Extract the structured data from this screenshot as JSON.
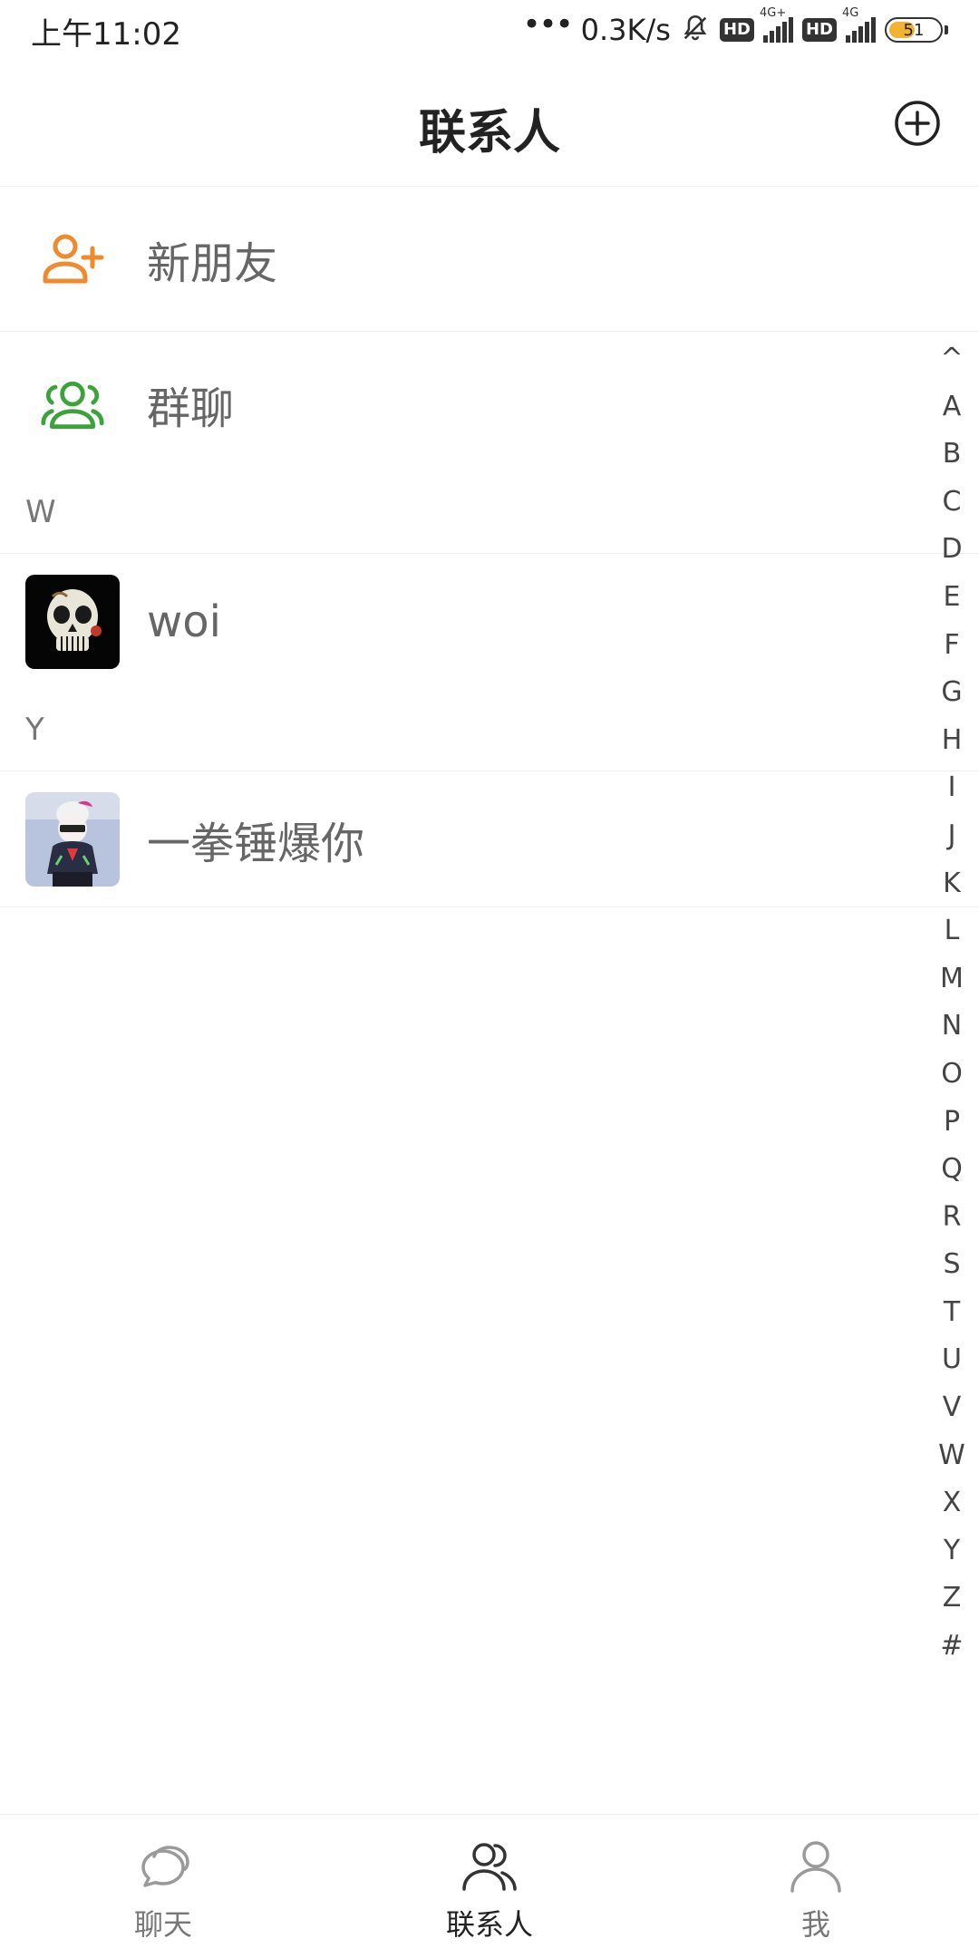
{
  "status_bar": {
    "time": "上午11:02",
    "dots": "•••",
    "speed": "0.3K/s",
    "hd1": "HD",
    "net1": "4G+",
    "hd2": "HD",
    "net2": "4G",
    "battery": "51",
    "battery_level": 0.51
  },
  "header": {
    "title": "联系人"
  },
  "fixed_items": [
    {
      "label": "新朋友",
      "icon": "add-friend-icon",
      "color": "#ef8a2e"
    },
    {
      "label": "群聊",
      "icon": "group-chat-icon",
      "color": "#3aa33a"
    }
  ],
  "sections": [
    {
      "letter": "W",
      "contacts": [
        {
          "name": "woi",
          "avatar": "skull-avatar"
        }
      ]
    },
    {
      "letter": "Y",
      "contacts": [
        {
          "name": "一拳锤爆你",
          "avatar": "anime-avatar"
        }
      ]
    }
  ],
  "alphabet_index": [
    "^",
    "A",
    "B",
    "C",
    "D",
    "E",
    "F",
    "G",
    "H",
    "I",
    "J",
    "K",
    "L",
    "M",
    "N",
    "O",
    "P",
    "Q",
    "R",
    "S",
    "T",
    "U",
    "V",
    "W",
    "X",
    "Y",
    "Z",
    "#"
  ],
  "bottom_nav": [
    {
      "label": "聊天",
      "icon": "chat-icon",
      "active": false
    },
    {
      "label": "联系人",
      "icon": "contacts-icon",
      "active": true
    },
    {
      "label": "我",
      "icon": "profile-icon",
      "active": false
    }
  ]
}
